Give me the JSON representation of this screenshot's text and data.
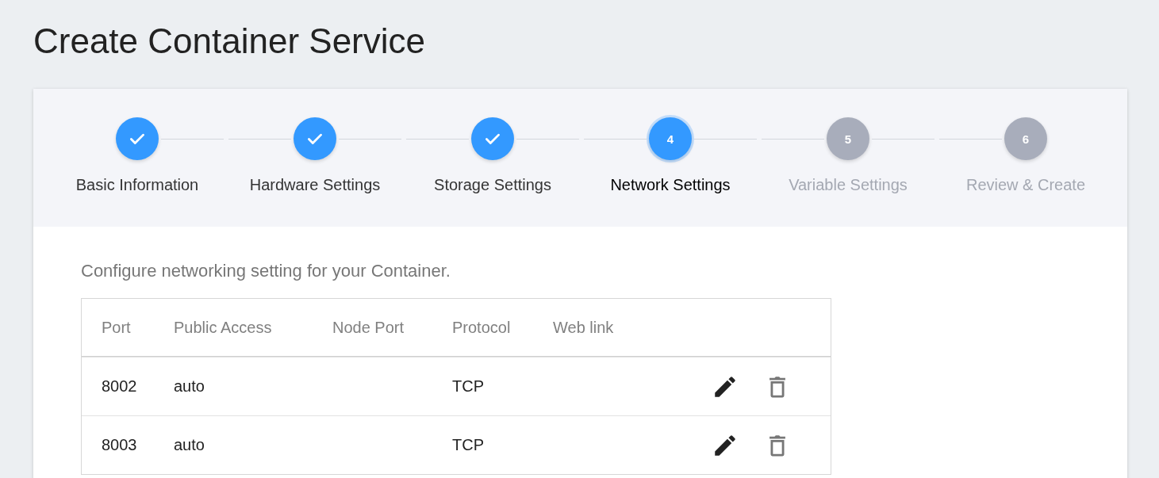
{
  "title": "Create Container Service",
  "steps": [
    {
      "label": "Basic Information",
      "completed": true,
      "selected": false
    },
    {
      "label": "Hardware Settings",
      "completed": true,
      "selected": false
    },
    {
      "label": "Storage Settings",
      "completed": true,
      "selected": false
    },
    {
      "label": "Network Settings",
      "number": "4",
      "completed": false,
      "selected": true
    },
    {
      "label": "Variable Settings",
      "number": "5",
      "completed": false,
      "selected": false
    },
    {
      "label": "Review & Create",
      "number": "6",
      "completed": false,
      "selected": false
    }
  ],
  "description": "Configure networking setting for your Container.",
  "table": {
    "columns": [
      "Port",
      "Public Access",
      "Node Port",
      "Protocol",
      "Web link"
    ],
    "rows": [
      [
        "8002",
        "auto",
        "",
        "TCP",
        ""
      ],
      [
        "8003",
        "auto",
        "",
        "TCP",
        ""
      ]
    ]
  }
}
